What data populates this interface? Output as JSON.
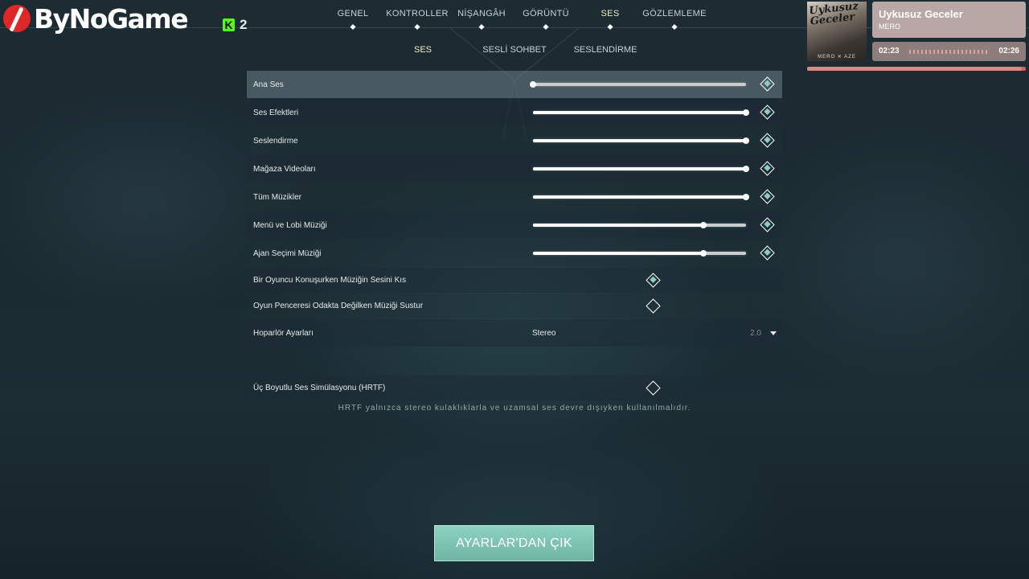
{
  "header": {
    "logo_text": "ByNoGame",
    "kick_icon": "K",
    "kick_count": "2"
  },
  "nav": {
    "tabs": [
      {
        "label": "GENEL",
        "active": false
      },
      {
        "label": "KONTROLLER",
        "active": false
      },
      {
        "label": "NİŞANGÂH",
        "active": false
      },
      {
        "label": "GÖRÜNTÜ",
        "active": false
      },
      {
        "label": "SES",
        "active": true
      },
      {
        "label": "GÖZLEMLEME",
        "active": false
      }
    ],
    "subtabs": [
      {
        "label": "SES",
        "active": true
      },
      {
        "label": "SESLİ SOHBET",
        "active": false
      },
      {
        "label": "SESLENDİRME",
        "active": false
      }
    ]
  },
  "music": {
    "cover_title": "Uykusuz Geceler",
    "cover_foot": "MERO ✕ AZE",
    "title": "Uykusuz Geceler",
    "artist": "MERO",
    "time_current": "02:23",
    "time_total": "02:26",
    "progress": 0.98,
    "colors": {
      "box": "#b9a7a6",
      "time_box": "#8f7d7b",
      "bar": "#d2625e"
    }
  },
  "settings": {
    "sliders": [
      {
        "label": "Ana Ses",
        "value": 0.0,
        "checked": true,
        "highlight": true
      },
      {
        "label": "Ses Efektleri",
        "value": 1.0,
        "checked": true
      },
      {
        "label": "Seslendirme",
        "value": 1.0,
        "checked": true
      },
      {
        "label": "Mağaza Videoları",
        "value": 1.0,
        "checked": true
      },
      {
        "label": "Tüm Müzikler",
        "value": 1.0,
        "checked": true
      },
      {
        "label": "Menü ve Lobi Müziği",
        "value": 0.8,
        "checked": true
      },
      {
        "label": "Ajan Seçimi Müziği",
        "value": 0.8,
        "checked": true
      }
    ],
    "toggles": [
      {
        "label": "Bir Oyuncu Konuşurken Müziğin Sesini Kıs",
        "checked": true
      },
      {
        "label": "Oyun Penceresi Odakta Değilken Müziği Sustur",
        "checked": false
      }
    ],
    "speaker": {
      "label": "Hoparlör Ayarları",
      "value": "Stereo",
      "sub": "2.0"
    },
    "hrtf": {
      "label": "Üç Boyutlu Ses Simülasyonu (HRTF)",
      "checked": false
    },
    "note": "HRTF yalnızca stereo kulaklıklarla ve uzamsal ses devre dışıyken kullanılmalıdır."
  },
  "footer": {
    "exit_label": "AYARLAR'DAN ÇIK"
  },
  "colors": {
    "accent": "#8ed2c0",
    "active_tab": "#f2ecc4",
    "diamond_fill": "#8fcbbc"
  }
}
